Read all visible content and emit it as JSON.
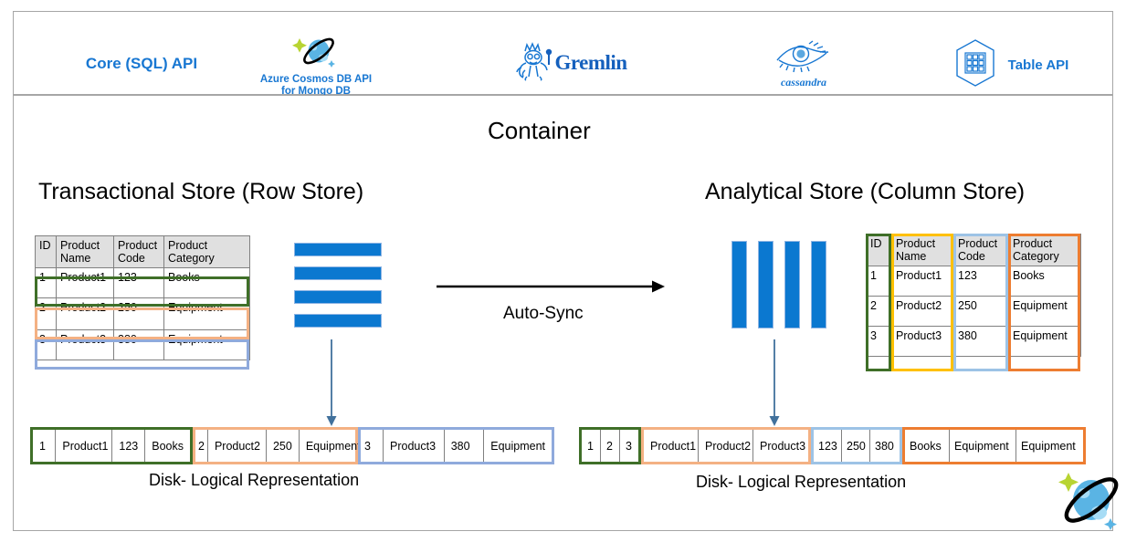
{
  "apis": {
    "core_sql": "Core (SQL) API",
    "mongo_line1": "Azure Cosmos DB API",
    "mongo_line2": "for Mongo DB",
    "gremlin": "Gremlin",
    "cassandra": "cassandra",
    "table_api": "Table API",
    "icons": {
      "cosmos": "cosmos-db-planet-icon",
      "gremlin": "gremlin-gremlin-icon",
      "cassandra": "cassandra-eye-icon",
      "table": "table-api-hexagon-icon"
    }
  },
  "headings": {
    "container": "Container",
    "transactional": "Transactional Store (Row Store)",
    "analytical": "Analytical Store (Column Store)",
    "auto_sync": "Auto-Sync",
    "disk_left": "Disk- Logical Representation",
    "disk_right": "Disk- Logical Representation"
  },
  "colors": {
    "accent_blue": "#1877d2",
    "bar_blue": "#0b78d0",
    "row1_green": "#3f6f28",
    "row2_peach": "#f4b183",
    "row3_blue": "#8faadc",
    "col_name_yellow": "#ffc000",
    "col_code_lightblue": "#9dc3e6",
    "col_category_orange": "#ed7d31",
    "frame_border": "#a6a6a6",
    "header_fill": "#e0e0e0"
  },
  "table": {
    "headers": [
      "ID",
      "Product Name",
      "Product Code",
      "Product Category"
    ],
    "headers_wrapped": [
      [
        "ID",
        ""
      ],
      [
        "Product",
        "Name"
      ],
      [
        "Product",
        "Code"
      ],
      [
        "Product",
        "Category"
      ]
    ],
    "rows": [
      [
        "1",
        "Product1",
        "123",
        "Books"
      ],
      [
        "2",
        "Product2",
        "250",
        "Equipment"
      ],
      [
        "3",
        "Product3",
        "380",
        "Equipment"
      ]
    ]
  },
  "row_store_disk": [
    {
      "color_key": "row1_green",
      "cells": [
        "1",
        "Product1",
        "123",
        "Books"
      ]
    },
    {
      "color_key": "row2_peach",
      "cells": [
        "2",
        "Product2",
        "250",
        "Equipment"
      ]
    },
    {
      "color_key": "row3_blue",
      "cells": [
        "3",
        "Product3",
        "380",
        "Equipment"
      ]
    }
  ],
  "column_store_disk": [
    {
      "color_key": "row1_green",
      "cells": [
        "1",
        "2",
        "3"
      ]
    },
    {
      "color_key": "row2_peach",
      "cells": [
        "Product1",
        "Product2",
        "Product3"
      ]
    },
    {
      "color_key": "col_code_lightblue",
      "cells": [
        "123",
        "250",
        "380"
      ]
    },
    {
      "color_key": "col_category_orange",
      "cells": [
        "Books",
        "Equipment",
        "Equipment"
      ]
    }
  ],
  "glyphs": {
    "horizontal_bars_count": 4,
    "vertical_bars_count": 4,
    "sync_arrow": "right-arrow-icon",
    "down_arrow_left": "down-arrow-icon",
    "down_arrow_right": "down-arrow-icon",
    "footer_logo": "cosmos-db-planet-icon"
  }
}
